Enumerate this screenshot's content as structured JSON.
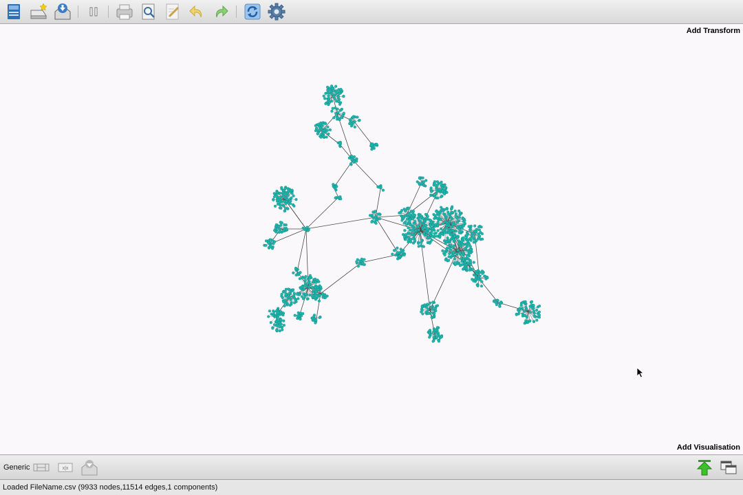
{
  "toolbar": {
    "buttons": [
      {
        "name": "open-project",
        "icon": "folder-blue-icon"
      },
      {
        "name": "new-workspace",
        "icon": "new-document-star-icon"
      },
      {
        "name": "import-data",
        "icon": "tray-import-icon"
      },
      {
        "name": "pause",
        "icon": "pause-icon"
      },
      {
        "name": "print",
        "icon": "printer-icon"
      },
      {
        "name": "print-preview",
        "icon": "magnifier-page-icon"
      },
      {
        "name": "edit",
        "icon": "pencil-page-icon"
      },
      {
        "name": "undo",
        "icon": "undo-arrow-icon"
      },
      {
        "name": "redo",
        "icon": "redo-arrow-icon"
      },
      {
        "name": "refresh",
        "icon": "refresh-icon"
      },
      {
        "name": "settings",
        "icon": "gear-icon"
      }
    ]
  },
  "canvas": {
    "add_transform_label": "Add Transform",
    "add_visualisation_label": "Add Visualisation",
    "node_color": "#1fb5ad",
    "edge_color": "#4a4a4a"
  },
  "bottombar": {
    "mode_label": "Generic",
    "buttons": [
      {
        "name": "layout-nodes",
        "icon": "layout-icon"
      },
      {
        "name": "xyz-view",
        "icon": "xyz-icon"
      },
      {
        "name": "export-view",
        "icon": "tray-export-icon"
      },
      {
        "name": "raise-panel",
        "icon": "green-up-arrow-icon"
      },
      {
        "name": "window-mode",
        "icon": "windows-icon"
      }
    ]
  },
  "status": {
    "message": "Loaded FileName.csv (9933 nodes,11514 edges,1 components)"
  }
}
